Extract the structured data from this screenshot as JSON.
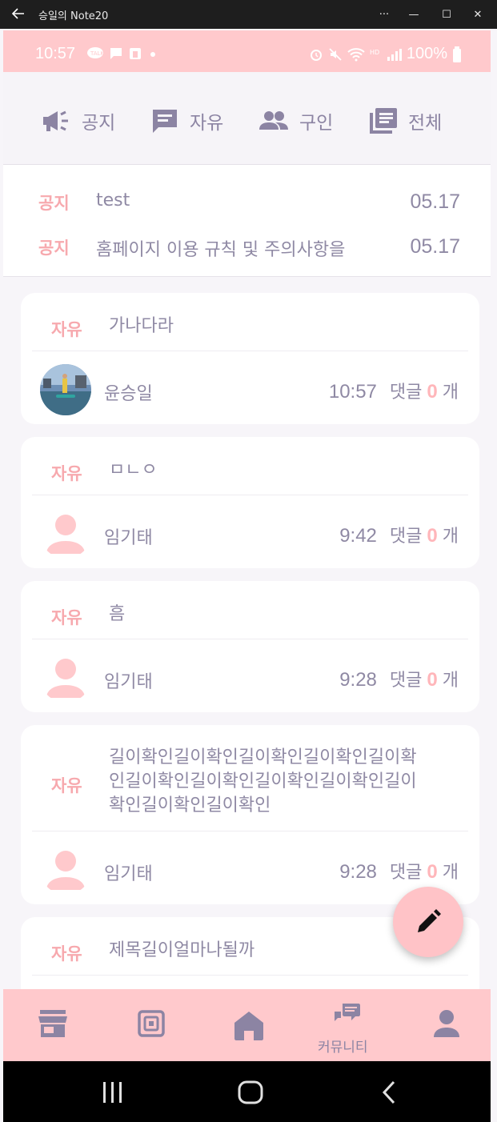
{
  "window": {
    "title": "승일의 Note20",
    "min_label": "—",
    "max_label": "☐",
    "close_label": "✕",
    "more_label": "···"
  },
  "status_bar": {
    "time": "10:57",
    "battery": "100%"
  },
  "categories": [
    {
      "label": "공지",
      "icon": "megaphone-icon"
    },
    {
      "label": "자유",
      "icon": "chat-icon"
    },
    {
      "label": "구인",
      "icon": "people-icon"
    },
    {
      "label": "전체",
      "icon": "library-icon"
    }
  ],
  "notices": [
    {
      "tag": "공지",
      "title": "test",
      "date": "05.17"
    },
    {
      "tag": "공지",
      "title": "홈페이지 이용 규칙 및 주의사항을",
      "date": "05.17"
    }
  ],
  "posts": [
    {
      "tag": "자유",
      "title": "가나다라",
      "author": "윤승일",
      "time": "10:57",
      "comments_label": "댓글",
      "comments": "0",
      "unit": "개"
    },
    {
      "tag": "자유",
      "title": "ㅁㄴㅇ",
      "author": "임기태",
      "time": "9:42",
      "comments_label": "댓글",
      "comments": "0",
      "unit": "개"
    },
    {
      "tag": "자유",
      "title": "흠",
      "author": "임기태",
      "time": "9:28",
      "comments_label": "댓글",
      "comments": "0",
      "unit": "개"
    },
    {
      "tag": "자유",
      "title_lines": [
        "길이확인길이확인길이확인길이확인길이확",
        "인길이확인길이확인길이확인길이확인길이",
        "확인길이확인길이확인"
      ],
      "author": "임기태",
      "time": "9:28",
      "comments_label": "댓글",
      "comments": "0",
      "unit": "개"
    },
    {
      "tag": "자유",
      "title": "제목길이얼마나될까"
    }
  ],
  "bottom_nav": {
    "community_label": "커뮤니티"
  },
  "colors": {
    "accent": "#ffc9cc",
    "tag": "#f7a9ae",
    "text": "#8f89a4"
  }
}
